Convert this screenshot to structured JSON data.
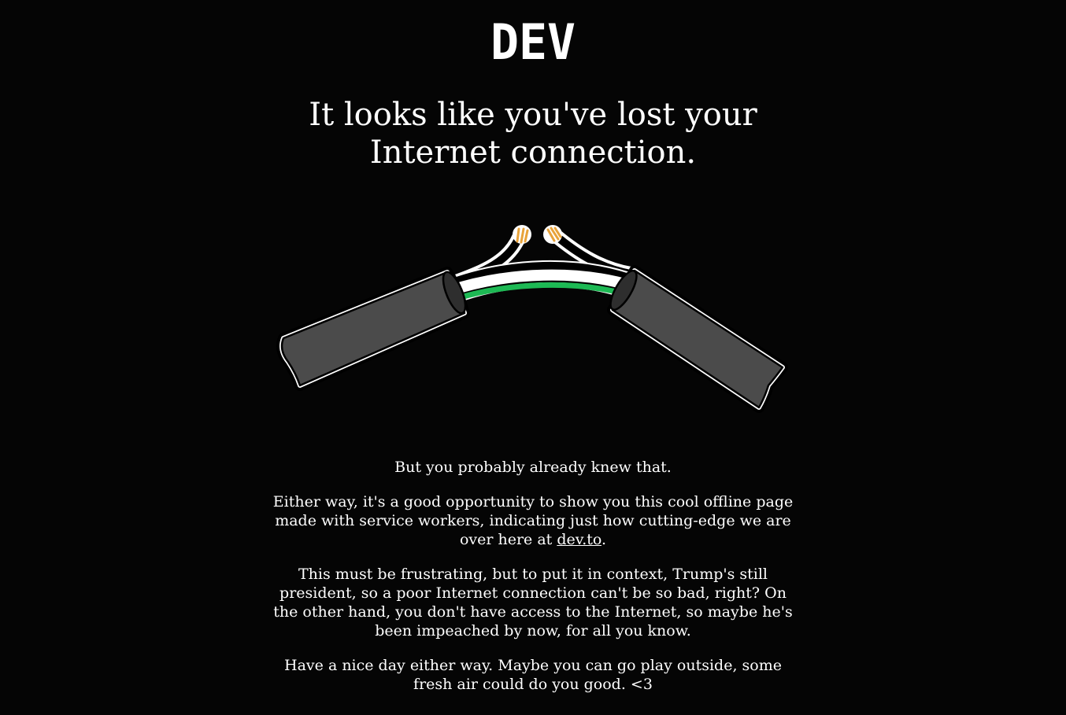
{
  "brand": {
    "logo_text": "DEV",
    "logo_color": "#ffffff"
  },
  "headline": {
    "line1": "It looks like you've lost your",
    "line2": "Internet connection."
  },
  "illustration": {
    "icon": "broken-cable-icon",
    "colors": {
      "jacket": "#4b4b4b",
      "outline": "#ffffff",
      "green_wire": "#1db954",
      "copper": "#e8a33a"
    }
  },
  "body": {
    "p1": "But you probably already knew that.",
    "p2_before": "Either way, it's a good opportunity to show you this cool offline page made with service workers, indicating just how cutting-edge we are over here at ",
    "p2_link": "dev.to",
    "p2_after": ".",
    "p3": "This must be frustrating, but to put it in context, Trump's still president, so a poor Internet connection can't be so bad, right? On the other hand, you don't have access to the Internet, so maybe he's been impeached by now, for all you know.",
    "p4": "Have a nice day either way. Maybe you can go play outside, some fresh air could do you good. <3"
  },
  "theme": {
    "background": "#050505",
    "text": "#ffffff"
  }
}
